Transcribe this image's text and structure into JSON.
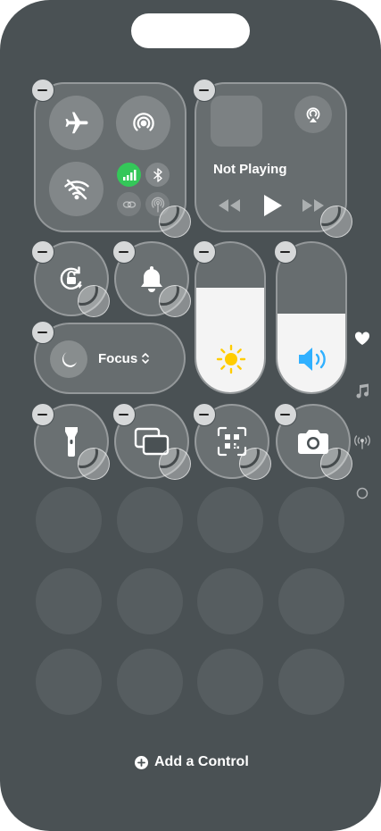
{
  "media": {
    "status": "Not Playing"
  },
  "focus": {
    "label": "Focus"
  },
  "footer": {
    "add_control": "Add a Control"
  },
  "colors": {
    "background": "#4a5154",
    "cellular_on": "#34c759",
    "sun": "#ffcc00",
    "speaker": "#30b0ff"
  },
  "sliders": {
    "brightness_level": 0.7,
    "volume_level": 0.53
  },
  "icons": [
    "airplane-icon",
    "airdrop-icon",
    "wifi-off-icon",
    "cellular-icon",
    "bluetooth-icon",
    "link-icon",
    "hotspot-icon",
    "airplay-icon",
    "rewind-icon",
    "play-icon",
    "forward-icon",
    "rotation-lock-icon",
    "bell-icon",
    "moon-icon",
    "sun-icon",
    "speaker-icon",
    "flashlight-icon",
    "screen-mirror-icon",
    "qr-scanner-icon",
    "camera-icon",
    "heart-icon",
    "music-note-icon",
    "antenna-icon",
    "circle-icon",
    "add-circle-icon"
  ]
}
